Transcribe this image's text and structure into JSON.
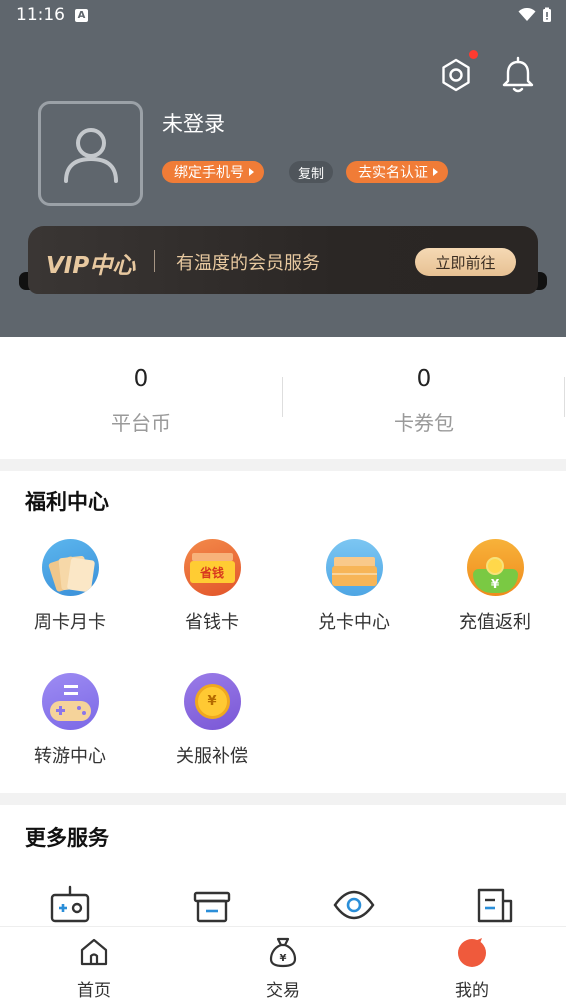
{
  "status_bar": {
    "time": "11:16",
    "indicator": "A"
  },
  "header": {
    "username": "未登录",
    "bind_phone": "绑定手机号",
    "copy": "复制",
    "verify": "去实名认证"
  },
  "vip": {
    "title": "VIP中心",
    "desc": "有温度的会员服务",
    "button": "立即前往"
  },
  "stats": [
    {
      "value": "0",
      "label": "平台币"
    },
    {
      "value": "0",
      "label": "卡券包"
    }
  ],
  "welfare": {
    "title": "福利中心",
    "items": [
      {
        "label": "周卡月卡",
        "icon": "card-stack-icon"
      },
      {
        "label": "省钱卡",
        "icon": "save-money-card-icon",
        "badge": "省钱"
      },
      {
        "label": "兑卡中心",
        "icon": "exchange-card-icon"
      },
      {
        "label": "充值返利",
        "icon": "recharge-rebate-icon",
        "symbol": "¥"
      },
      {
        "label": "转游中心",
        "icon": "game-transfer-icon"
      },
      {
        "label": "关服补偿",
        "icon": "compensation-coin-icon",
        "symbol": "¥"
      }
    ]
  },
  "more": {
    "title": "更多服务",
    "items": [
      {
        "icon": "radio-icon"
      },
      {
        "icon": "gift-box-icon"
      },
      {
        "icon": "eye-icon"
      },
      {
        "icon": "news-icon"
      }
    ]
  },
  "nav": [
    {
      "label": "首页",
      "icon": "home-icon"
    },
    {
      "label": "交易",
      "icon": "money-bag-icon",
      "symbol": "¥"
    },
    {
      "label": "我的",
      "icon": "profile-tab-icon"
    }
  ],
  "colors": {
    "accent": "#f07c37",
    "header_bg": "#5f666d",
    "vip_gold": "#e8c9a0"
  }
}
